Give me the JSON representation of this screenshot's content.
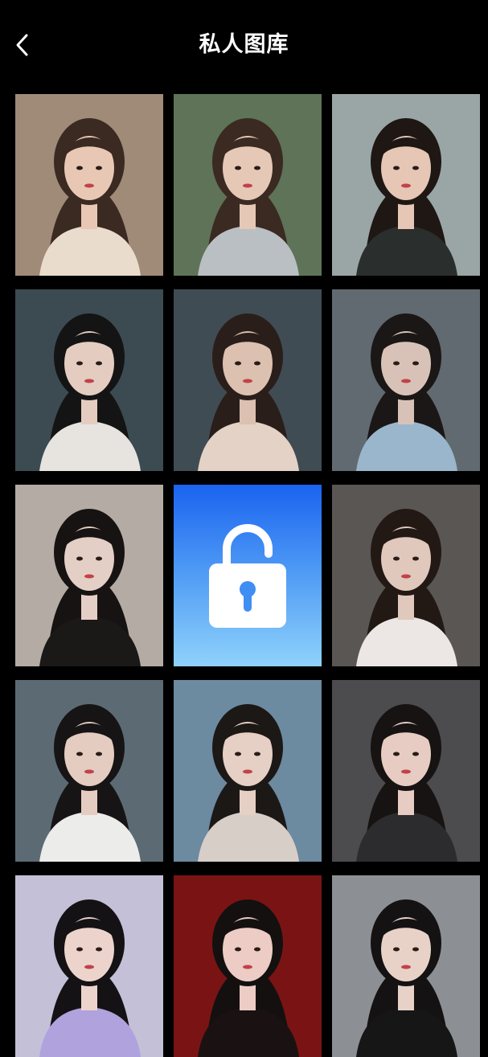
{
  "header": {
    "title": "私人图库",
    "back_icon": "chevron-left-icon"
  },
  "theme": {
    "background": "#000000",
    "text": "#ffffff",
    "lock_gradient_top": "#1a63f0",
    "lock_gradient_bottom": "#8fd2fb"
  },
  "gallery": {
    "tiles": [
      {
        "type": "photo",
        "bg": "#a08a78",
        "hair": "#3a2a22",
        "skin": "#e8c8b4",
        "cloth": "#e9dccd"
      },
      {
        "type": "photo",
        "bg": "#5e7358",
        "hair": "#3a2a22",
        "skin": "#e6c8b7",
        "cloth": "#b9bfc2"
      },
      {
        "type": "photo",
        "bg": "#9aa6a6",
        "hair": "#1e1714",
        "skin": "#e6c6b4",
        "cloth": "#2a2e2c"
      },
      {
        "type": "photo",
        "bg": "#3c4a52",
        "hair": "#141414",
        "skin": "#e4ccc0",
        "cloth": "#e7e4e0"
      },
      {
        "type": "photo",
        "bg": "#404c54",
        "hair": "#2a1e1a",
        "skin": "#dcc0b0",
        "cloth": "#e4d2c6"
      },
      {
        "type": "photo",
        "bg": "#606a70",
        "hair": "#1a1716",
        "skin": "#d8c2b8",
        "cloth": "#9ab6cc"
      },
      {
        "type": "photo",
        "bg": "#b4aca4",
        "hair": "#171312",
        "skin": "#e4cfc6",
        "cloth": "#1b1818"
      },
      {
        "type": "locked",
        "icon": "lock-icon"
      },
      {
        "type": "photo",
        "bg": "#5a5654",
        "hair": "#221915",
        "skin": "#e0c8bc",
        "cloth": "#ece6e4"
      },
      {
        "type": "photo",
        "bg": "#5c6a74",
        "hair": "#161414",
        "skin": "#e4ccc0",
        "cloth": "#ececea"
      },
      {
        "type": "photo",
        "bg": "#6c8aa0",
        "hair": "#1c1816",
        "skin": "#e6cfc4",
        "cloth": "#d8cec8"
      },
      {
        "type": "photo",
        "bg": "#4c4c4e",
        "hair": "#161312",
        "skin": "#e6ccc2",
        "cloth": "#2c2c2e"
      },
      {
        "type": "photo",
        "bg": "#c4c0d8",
        "hair": "#141214",
        "skin": "#ecd4cc",
        "cloth": "#b0a2dc"
      },
      {
        "type": "photo",
        "bg": "#7a1414",
        "hair": "#141010",
        "skin": "#ecccc4",
        "cloth": "#1a1212"
      },
      {
        "type": "photo",
        "bg": "#8c9094",
        "hair": "#141212",
        "skin": "#e8d2c8",
        "cloth": "#161616"
      }
    ]
  }
}
